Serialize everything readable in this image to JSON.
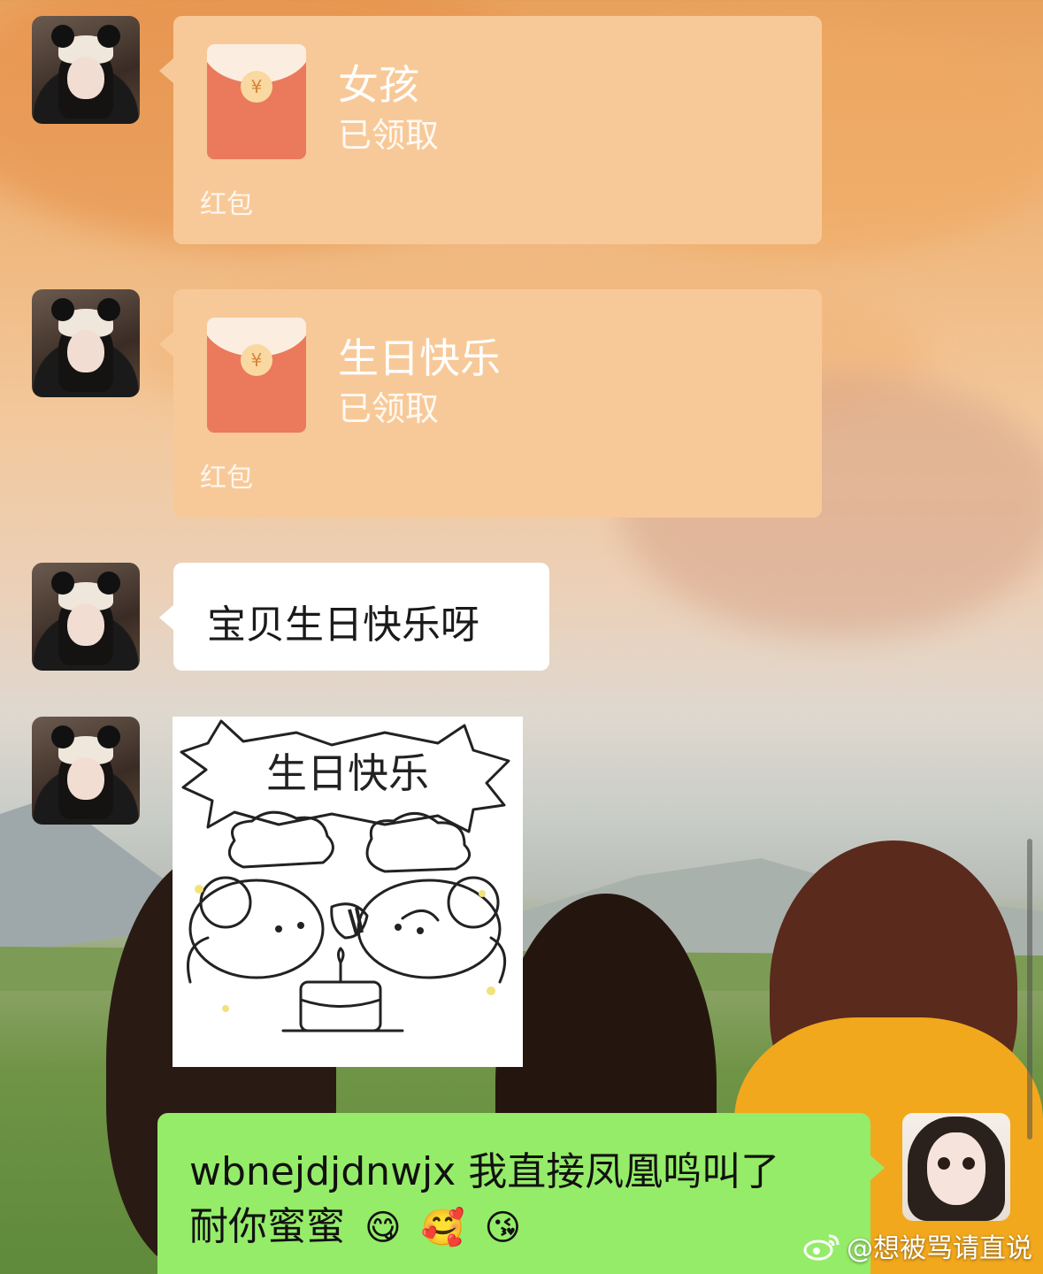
{
  "messages": {
    "redpacket1": {
      "title": "女孩",
      "status": "已领取",
      "label": "红包"
    },
    "redpacket2": {
      "title": "生日快乐",
      "status": "已领取",
      "label": "红包"
    },
    "text1": "宝贝生日快乐呀",
    "sticker": {
      "caption": "生日快乐"
    },
    "reply": {
      "line1": "wbnejdjdnwjx 我直接凤凰鸣叫了",
      "line2": "耐你蜜蜜",
      "emojis": [
        "😋",
        "🥰",
        "😘"
      ]
    }
  },
  "coin_symbol": "¥",
  "watermark": {
    "text": "@想被骂请直说"
  },
  "colors": {
    "redpacket_bg": "#f8c998",
    "envelope": "#ea7a5b",
    "my_bubble": "#95ec69",
    "their_bubble": "#ffffff"
  }
}
